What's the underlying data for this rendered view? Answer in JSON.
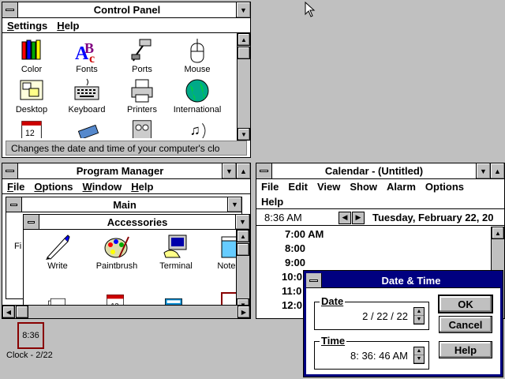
{
  "control_panel": {
    "title": "Control Panel",
    "menu": [
      "Settings",
      "Help"
    ],
    "icons": [
      {
        "label": "Color",
        "icon": "color-icon"
      },
      {
        "label": "Fonts",
        "icon": "fonts-icon"
      },
      {
        "label": "Ports",
        "icon": "ports-icon"
      },
      {
        "label": "Mouse",
        "icon": "mouse-icon"
      },
      {
        "label": "Desktop",
        "icon": "desktop-icon"
      },
      {
        "label": "Keyboard",
        "icon": "keyboard-icon"
      },
      {
        "label": "Printers",
        "icon": "printers-icon"
      },
      {
        "label": "International",
        "icon": "international-icon"
      }
    ],
    "status": "Changes the date and time of your computer's clo"
  },
  "program_manager": {
    "title": "Program Manager",
    "menu": [
      "File",
      "Options",
      "Window",
      "Help"
    ],
    "main_group_title": "Main",
    "main_partial_label": "Fi",
    "accessories_title": "Accessories",
    "accessories_icons": [
      {
        "label": "Write",
        "icon": "write-icon"
      },
      {
        "label": "Paintbrush",
        "icon": "paintbrush-icon"
      },
      {
        "label": "Terminal",
        "icon": "terminal-icon"
      },
      {
        "label": "Notep",
        "icon": "notepad-icon"
      }
    ]
  },
  "calendar": {
    "title": "Calendar - (Untitled)",
    "menu": [
      "File",
      "Edit",
      "View",
      "Show",
      "Alarm",
      "Options",
      "Help"
    ],
    "current_time": "8:36 AM",
    "date_label": "Tuesday, February 22, 20",
    "times": [
      "7:00 AM",
      "8:00",
      "9:00",
      "10:0",
      "11:0",
      "12:0"
    ]
  },
  "date_time_dialog": {
    "title": "Date & Time",
    "date_label": "Date",
    "date_value": "2 / 22 / 22",
    "time_label": "Time",
    "time_value": "8: 36: 46 AM",
    "ok": "OK",
    "cancel": "Cancel",
    "help": "Help"
  },
  "clock_icon": {
    "time": "8:36",
    "label": "Clock - 2/22"
  },
  "colors": {
    "desktop": "#c0c0c0",
    "active_title": "#000080",
    "inactive_title": "#ffffff"
  }
}
